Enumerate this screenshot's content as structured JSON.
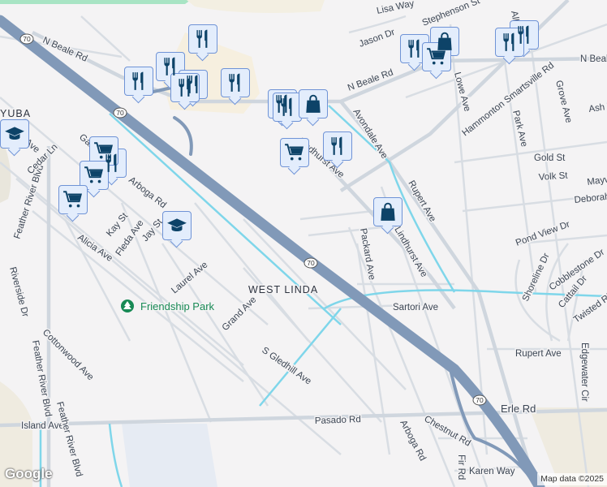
{
  "map": {
    "areas": {
      "west_linda": "WEST LINDA",
      "yuba": "YUBA"
    },
    "park": "Friendship Park",
    "highway_shield": "70",
    "streets": [
      "N Beale Rd",
      "N Beale Rd",
      "N Beale",
      "Lisa Way",
      "Stephenson St",
      "Jason Dr",
      "Avondale Ave",
      "Hammonton Smartsville Rd",
      "Lowe Ave",
      "Park Ave",
      "Grove Ave",
      "Ash Way",
      "Gold St",
      "Volk St",
      "Mayw",
      "Deborah",
      "Rupert Ave",
      "Lindhurst Ave",
      "Lindhurst Ave",
      "Packard Ave",
      "Pond View Dr",
      "Cobblestone Dr",
      "Shoreline Dr",
      "Cattail Dr",
      "Twisted Riv",
      "Sartori Ave",
      "Rupert Ave",
      "Edgewater Cir",
      "Erle Rd",
      "Pasado Rd",
      "Island Ave",
      "Arboga Rd",
      "Chestnut Rd",
      "Karen Way",
      "Fir Rd",
      "S Gledhill Ave",
      "Grand Ave",
      "Laurel Ave",
      "Jay St",
      "Fleda Ave",
      "Kay St",
      "Arboga Rd",
      "Alicia Ave",
      "Cottonwood Ave",
      "Riverside Dr",
      "Feather River Blvd",
      "Feather River Blvd",
      "Feather River Blvd",
      "Cedar Ln",
      "Ave",
      "Garden",
      "Alb"
    ],
    "colors": {
      "highway": "#8199b8",
      "road": "#d5dbe2",
      "water": "#7fd6ea",
      "marker_bg": "#e3edfc",
      "marker_border": "#6f93d6",
      "icon": "#0d4368",
      "park": "#188a55"
    }
  },
  "markers": [
    {
      "type": "restaurant-icon"
    },
    {
      "type": "restaurant-icon"
    },
    {
      "type": "restaurant-icon"
    },
    {
      "type": "restaurant-icon"
    },
    {
      "type": "restaurant-icon"
    },
    {
      "type": "restaurant-icon"
    },
    {
      "type": "restaurant-icon"
    },
    {
      "type": "restaurant-icon"
    },
    {
      "type": "restaurant-icon"
    },
    {
      "type": "restaurant-icon"
    },
    {
      "type": "restaurant-icon"
    },
    {
      "type": "restaurant-icon"
    },
    {
      "type": "restaurant-icon"
    },
    {
      "type": "shopping-bag-icon"
    },
    {
      "type": "shopping-bag-icon"
    },
    {
      "type": "shopping-bag-icon"
    },
    {
      "type": "shopping-cart-icon"
    },
    {
      "type": "shopping-cart-icon"
    },
    {
      "type": "shopping-cart-icon"
    },
    {
      "type": "shopping-cart-icon"
    },
    {
      "type": "shopping-cart-icon"
    },
    {
      "type": "school-icon"
    },
    {
      "type": "school-icon"
    }
  ],
  "attribution": "Map data ©2025",
  "logo": "Google"
}
